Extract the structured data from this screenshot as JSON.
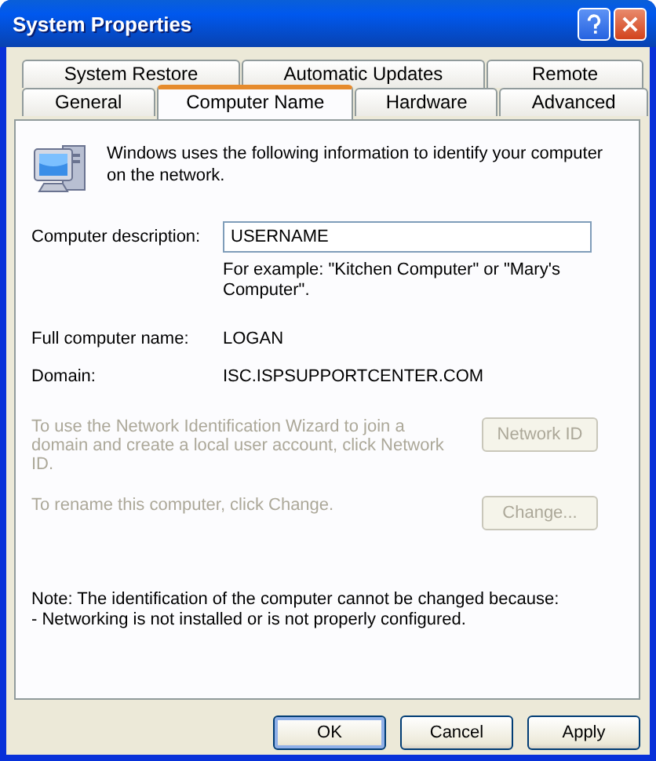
{
  "window": {
    "title": "System Properties"
  },
  "tab_rows": [
    [
      {
        "label": "System Restore",
        "selected": false
      },
      {
        "label": "Automatic Updates",
        "selected": false
      },
      {
        "label": "Remote",
        "selected": false
      }
    ],
    [
      {
        "label": "General",
        "selected": false
      },
      {
        "label": "Computer Name",
        "selected": true
      },
      {
        "label": "Hardware",
        "selected": false
      },
      {
        "label": "Advanced",
        "selected": false
      }
    ]
  ],
  "intro": "Windows uses the following information to identify your computer on the network.",
  "description": {
    "label": "Computer description:",
    "value": "USERNAME",
    "hint": "For example: \"Kitchen Computer\" or \"Mary's Computer\"."
  },
  "info": [
    {
      "label": "Full computer name:",
      "value": "LOGAN"
    },
    {
      "label": "Domain:",
      "value": "ISC.ISPSUPPORTCENTER.COM"
    }
  ],
  "actions": [
    {
      "text": "To use the Network Identification Wizard to join a domain and create a local user account, click Network ID.",
      "button": "Network ID",
      "disabled": true
    },
    {
      "text": "To rename this computer, click Change.",
      "button": "Change...",
      "disabled": true
    }
  ],
  "note": [
    "Note: The identification of the computer cannot be changed because:",
    "- Networking is not installed or is not properly configured."
  ],
  "buttons": [
    {
      "label": "OK",
      "default": true
    },
    {
      "label": "Cancel",
      "default": false
    },
    {
      "label": "Apply",
      "default": false
    }
  ]
}
